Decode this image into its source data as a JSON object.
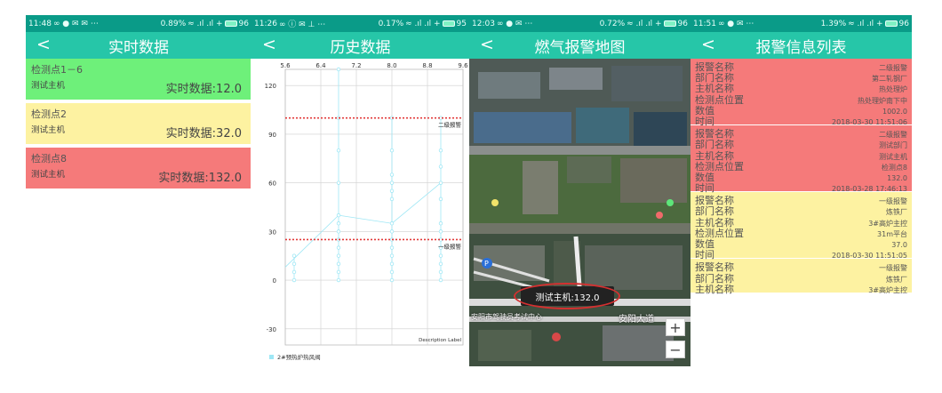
{
  "screens": [
    {
      "status": {
        "time": "11:48",
        "net": "0.89%",
        "battery": "96"
      },
      "title": "实时数据",
      "back": "<",
      "cards": [
        {
          "name": "检测点1－6",
          "host": "测试主机",
          "value": "实时数据:12.0",
          "color": "#6ef07a"
        },
        {
          "name": "检测点2",
          "host": "测试主机",
          "value": "实时数据:32.0",
          "color": "#fdf2a1"
        },
        {
          "name": "检测点8",
          "host": "测试主机",
          "value": "实时数据:132.0",
          "color": "#f57a7a"
        }
      ]
    },
    {
      "status": {
        "time": "11:26",
        "net": "0.17%",
        "battery": "95"
      },
      "title": "历史数据",
      "back": "<",
      "chart_data": {
        "type": "scatter",
        "x_ticks": [
          "5.6",
          "6.4",
          "7.2",
          "8.0",
          "8.8",
          "9.6"
        ],
        "y_ticks": [
          "120",
          "90",
          "60",
          "30",
          "0",
          "-30"
        ],
        "xlim": [
          5.6,
          9.6
        ],
        "ylim": [
          -40,
          130
        ],
        "limit_lines": [
          {
            "label": "二级报警",
            "value": 100
          },
          {
            "label": "一级报警",
            "value": 25
          }
        ],
        "description": "Description Label",
        "series": [
          {
            "name": "2#预热炉热风阀",
            "columns": [
              {
                "x": 5.8,
                "values": [
                  0,
                  5,
                  10,
                  15
                ]
              },
              {
                "x": 6.8,
                "values": [
                  0,
                  5,
                  10,
                  15,
                  20,
                  25,
                  30,
                  35,
                  40,
                  60,
                  80,
                  100,
                  130
                ]
              },
              {
                "x": 8.0,
                "values": [
                  0,
                  5,
                  10,
                  15,
                  20,
                  25,
                  30,
                  35,
                  50,
                  55,
                  60,
                  65,
                  80,
                  100
                ]
              },
              {
                "x": 9.1,
                "values": [
                  0,
                  5,
                  10,
                  15,
                  20,
                  25,
                  30,
                  35,
                  50,
                  60,
                  70,
                  80,
                  100
                ]
              }
            ],
            "trend": [
              [
                5.6,
                8
              ],
              [
                6.8,
                40
              ],
              [
                8.0,
                35
              ],
              [
                9.1,
                60
              ]
            ],
            "color": "#9ee7f5"
          }
        ]
      }
    },
    {
      "status": {
        "time": "12:03",
        "net": "0.72%",
        "battery": "96"
      },
      "title": "燃气报警地图",
      "back": "<",
      "map": {
        "popup": "测试主机:132.0",
        "road_labels": [
          "安阳大道",
          "安阳市驾驶员考试中心"
        ],
        "zoom_in": "+",
        "zoom_out": "−",
        "popup_ring_color": "#d33030"
      }
    },
    {
      "status": {
        "time": "11:51",
        "net": "1.39%",
        "battery": "96"
      },
      "title": "报警信息列表",
      "back": "<",
      "alarms": [
        {
          "color": "#f57a7a",
          "fields": [
            {
              "k": "报警名称",
              "v": "二级报警"
            },
            {
              "k": "部门名称",
              "v": "第二轧钢厂"
            },
            {
              "k": "主机名称",
              "v": "热处理炉"
            },
            {
              "k": "检测点位置",
              "v": "热处理炉南下中"
            },
            {
              "k": "数值",
              "v": "1002.0"
            },
            {
              "k": "时间",
              "v": "2018-03-30 11:51:06"
            }
          ]
        },
        {
          "color": "#f57a7a",
          "fields": [
            {
              "k": "报警名称",
              "v": "二级报警"
            },
            {
              "k": "部门名称",
              "v": "测试部门"
            },
            {
              "k": "主机名称",
              "v": "测试主机"
            },
            {
              "k": "检测点位置",
              "v": "检测点8"
            },
            {
              "k": "数值",
              "v": "132.0"
            },
            {
              "k": "时间",
              "v": "2018-03-28 17:46:13"
            }
          ]
        },
        {
          "color": "#fdf2a1",
          "fields": [
            {
              "k": "报警名称",
              "v": "一级报警"
            },
            {
              "k": "部门名称",
              "v": "炼铁厂"
            },
            {
              "k": "主机名称",
              "v": "3#高炉主控"
            },
            {
              "k": "检测点位置",
              "v": "31m平台"
            },
            {
              "k": "数值",
              "v": "37.0"
            },
            {
              "k": "时间",
              "v": "2018-03-30 11:51:05"
            }
          ]
        },
        {
          "color": "#fdf2a1",
          "fields": [
            {
              "k": "报警名称",
              "v": "一级报警"
            },
            {
              "k": "部门名称",
              "v": "炼铁厂"
            },
            {
              "k": "主机名称",
              "v": "3#高炉主控"
            }
          ]
        }
      ]
    }
  ]
}
